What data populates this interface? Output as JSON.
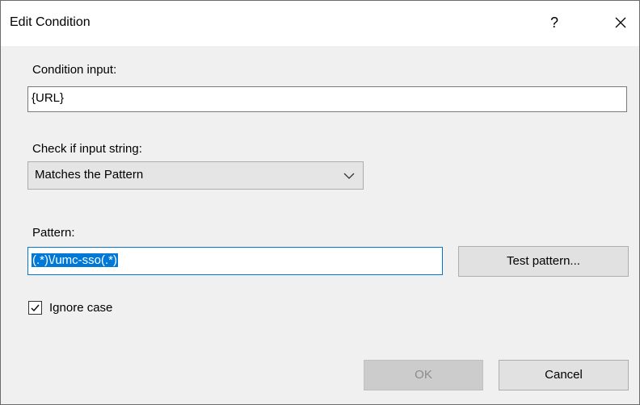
{
  "window": {
    "title": "Edit Condition",
    "help_label": "?"
  },
  "condition_input": {
    "label": "Condition input:",
    "value": "{URL}"
  },
  "check": {
    "label": "Check if input string:",
    "selected": "Matches the Pattern"
  },
  "pattern": {
    "label": "Pattern:",
    "value": "(.*)\\/umc-sso(.*)",
    "test_button": "Test pattern..."
  },
  "ignore_case": {
    "label": "Ignore case",
    "checked": true
  },
  "footer": {
    "ok_label": "OK",
    "cancel_label": "Cancel"
  },
  "colors": {
    "selection": "#0078d7",
    "dialog_bg": "#f0f0f0"
  }
}
